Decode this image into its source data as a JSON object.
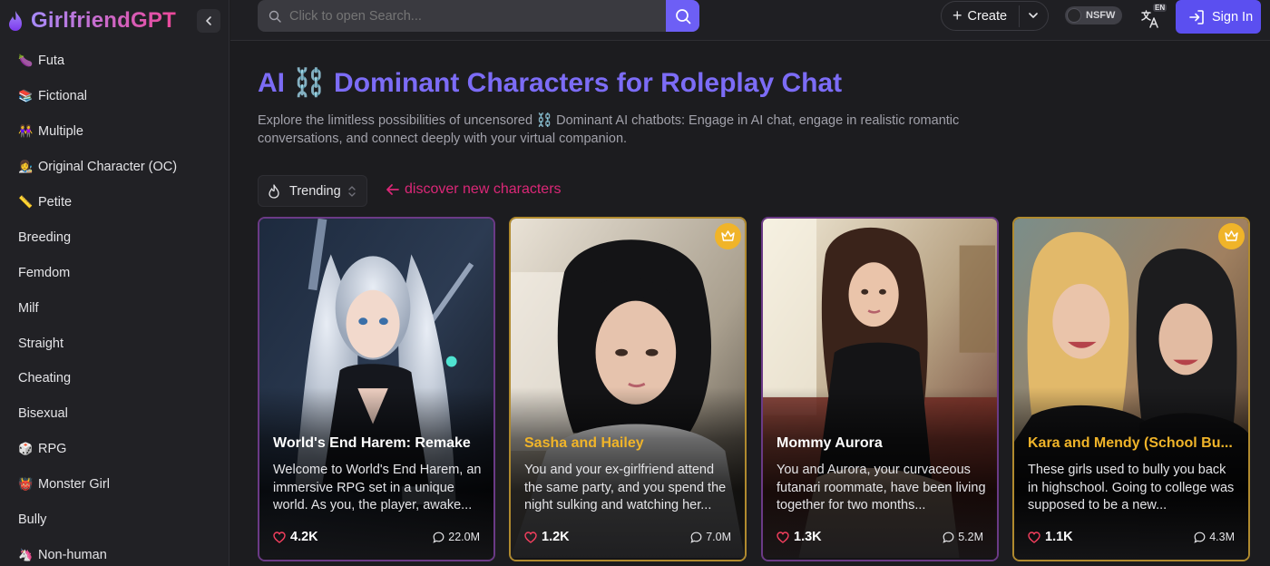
{
  "brand": {
    "name": "GirlfriendGPT"
  },
  "sidebar": {
    "items": [
      {
        "label": "Futa",
        "icon": "🍆"
      },
      {
        "label": "Fictional",
        "icon": "📚"
      },
      {
        "label": "Multiple",
        "icon": "👭"
      },
      {
        "label": "Original Character (OC)",
        "icon": "👩‍🎨"
      },
      {
        "label": "Petite",
        "icon": "📏"
      },
      {
        "label": "Breeding",
        "icon": ""
      },
      {
        "label": "Femdom",
        "icon": ""
      },
      {
        "label": "Milf",
        "icon": ""
      },
      {
        "label": "Straight",
        "icon": ""
      },
      {
        "label": "Cheating",
        "icon": ""
      },
      {
        "label": "Bisexual",
        "icon": ""
      },
      {
        "label": "RPG",
        "icon": "🎲"
      },
      {
        "label": "Monster Girl",
        "icon": "👹"
      },
      {
        "label": "Bully",
        "icon": ""
      },
      {
        "label": "Non-human",
        "icon": "🦄"
      }
    ]
  },
  "topbar": {
    "search_placeholder": "Click to open Search...",
    "create_label": "Create",
    "nsfw_label": "NSFW",
    "lang_badge": "EN",
    "signin_label": "Sign In"
  },
  "main": {
    "title": "AI ⛓️ Dominant Characters for Roleplay Chat",
    "description": "Explore the limitless possibilities of uncensored ⛓️ Dominant AI chatbots: Engage in AI chat, engage in realistic romantic conversations, and connect deeply with your virtual companion.",
    "sort_label": "Trending",
    "discover_label": "discover new characters"
  },
  "cards": [
    {
      "name": "World's End Harem: Remake",
      "description": "Welcome to World's End Harem, an immersive RPG set in a unique world. As you, the player, awake...",
      "likes": "4.2K",
      "messages": "22.0M",
      "premium": false
    },
    {
      "name": "Sasha and Hailey",
      "description": "You and your ex-girlfriend attend the same party, and you spend the night sulking and watching her...",
      "likes": "1.2K",
      "messages": "7.0M",
      "premium": true
    },
    {
      "name": "Mommy Aurora",
      "description": "You and Aurora, your curvaceous futanari roommate, have been living together for two months...",
      "likes": "1.3K",
      "messages": "5.2M",
      "premium": false
    },
    {
      "name": "Kara and Mendy (School Bu...",
      "description": "These girls used to bully you back in highschool. Going to college was supposed to be a new...",
      "likes": "1.1K",
      "messages": "4.3M",
      "premium": true
    }
  ],
  "colors": {
    "accent": "#7c6cf6",
    "button": "#5b4ff0",
    "discover": "#db2777",
    "premium": "#f0b429"
  }
}
